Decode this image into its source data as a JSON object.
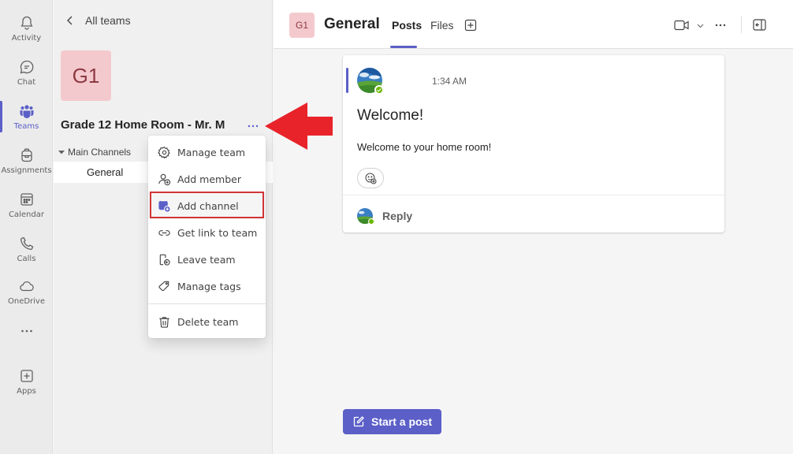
{
  "rail": {
    "items": [
      {
        "label": "Activity",
        "icon": "bell-icon"
      },
      {
        "label": "Chat",
        "icon": "chat-icon"
      },
      {
        "label": "Teams",
        "icon": "teams-icon"
      },
      {
        "label": "Assignments",
        "icon": "backpack-icon"
      },
      {
        "label": "Calendar",
        "icon": "calendar-icon"
      },
      {
        "label": "Calls",
        "icon": "phone-icon"
      },
      {
        "label": "OneDrive",
        "icon": "cloud-icon"
      },
      {
        "label": "",
        "icon": "more-horizontal-icon"
      },
      {
        "label": "Apps",
        "icon": "plus-square-icon"
      }
    ],
    "active": "Teams",
    "accent": "#5b5fc7"
  },
  "panel": {
    "back_label": "All teams",
    "team_avatar_text": "G1",
    "team_name": "Grade 12 Home Room - Mr. M",
    "more_label": "···",
    "section_label": "Main Channels",
    "channel_label": "General"
  },
  "menu": {
    "items": [
      {
        "label": "Manage team",
        "icon": "gear-icon"
      },
      {
        "label": "Add member",
        "icon": "add-person-icon"
      },
      {
        "label": "Add channel",
        "icon": "add-channel-icon"
      },
      {
        "label": "Get link to team",
        "icon": "link-icon"
      },
      {
        "label": "Leave team",
        "icon": "leave-icon"
      },
      {
        "label": "Manage tags",
        "icon": "tag-icon"
      },
      {
        "label": "Delete team",
        "icon": "trash-icon"
      }
    ],
    "highlighted": "Add channel",
    "highlight_color": "#d13438"
  },
  "header": {
    "avatar_text": "G1",
    "title": "General",
    "tabs": [
      {
        "label": "Posts",
        "active": true
      },
      {
        "label": "Files",
        "active": false
      }
    ]
  },
  "post": {
    "time": "1:34 AM",
    "title": "Welcome!",
    "body": "Welcome to your home room!",
    "reply_label": "Reply"
  },
  "start_post_label": "Start a post",
  "arrow_color": "#e8232a"
}
